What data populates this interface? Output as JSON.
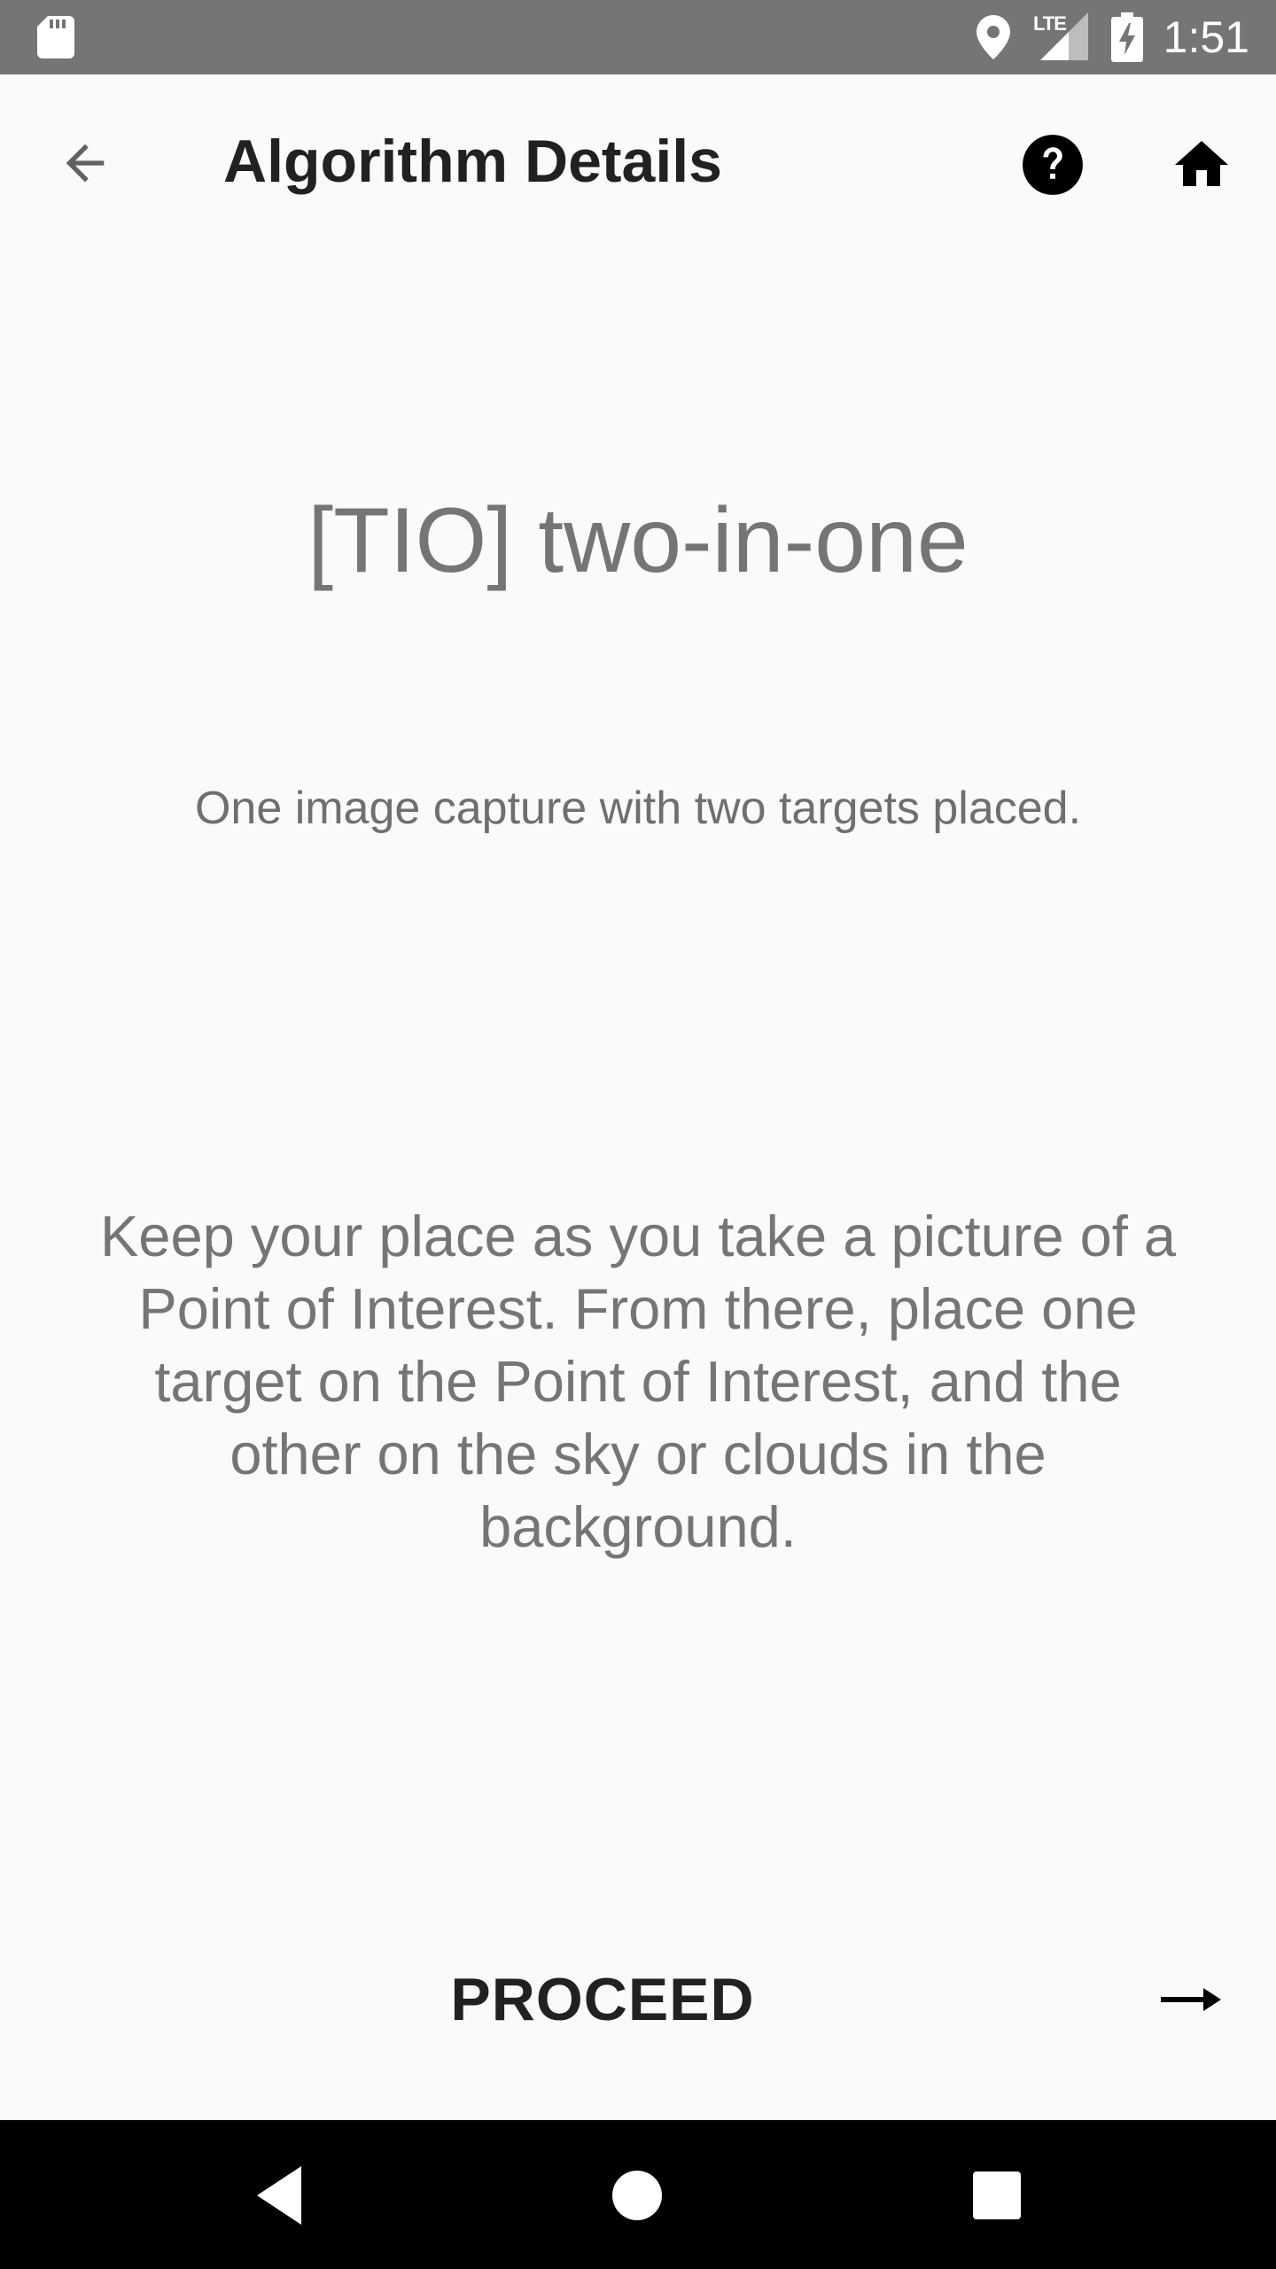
{
  "status_bar": {
    "time": "1:51",
    "network": "LTE",
    "icons": [
      "sd-card-icon",
      "location-icon",
      "signal-icon",
      "battery-charging-icon"
    ]
  },
  "app_bar": {
    "title": "Algorithm Details",
    "icons": {
      "back": "arrow-back-icon",
      "help": "help-circle-icon",
      "home": "home-icon"
    }
  },
  "content": {
    "algorithm_name": "[TIO] two-in-one",
    "summary": "One image capture with two targets placed.",
    "description": "Keep your place as you take a picture of a Point of Interest. From there, place one target on the Point of Interest, and the other on the sky or clouds in the background."
  },
  "proceed": {
    "label": "PROCEED",
    "icon": "arrow-right-icon"
  },
  "nav_bar": {
    "icons": [
      "nav-back-icon",
      "nav-home-icon",
      "nav-recents-icon"
    ]
  },
  "colors": {
    "status_bar": "#757575",
    "background": "#fafafa",
    "title_text": "#212121",
    "body_text": "#757575",
    "nav_bar": "#000000"
  }
}
